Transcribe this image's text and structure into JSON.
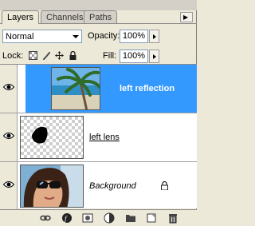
{
  "tabs": [
    {
      "label": "Layers",
      "active": true
    },
    {
      "label": "Channels",
      "active": false
    },
    {
      "label": "Paths",
      "active": false
    }
  ],
  "blend_mode": "Normal",
  "opacity": {
    "label": "Opacity:",
    "value": "100%"
  },
  "lock": {
    "label": "Lock:",
    "icons": [
      "lock-transparent-icon",
      "lock-paint-icon",
      "lock-move-icon",
      "lock-all-icon"
    ]
  },
  "fill": {
    "label": "Fill:",
    "value": "100%"
  },
  "layers": [
    {
      "name": "left reflection",
      "selected": true,
      "visible": true,
      "thumb": "palm-beach"
    },
    {
      "name": "left lens",
      "selected": false,
      "visible": true,
      "thumb": "black-blob"
    },
    {
      "name": "Background",
      "selected": false,
      "visible": true,
      "locked": true,
      "thumb": "woman-sunglasses"
    }
  ],
  "toolbar_icons": [
    "link-layers-icon",
    "layer-style-icon",
    "layer-mask-icon",
    "adjustment-layer-icon",
    "new-group-icon",
    "new-layer-icon",
    "delete-layer-icon"
  ],
  "colors": {
    "selection": "#3399ff",
    "panel": "#ece9d8"
  }
}
